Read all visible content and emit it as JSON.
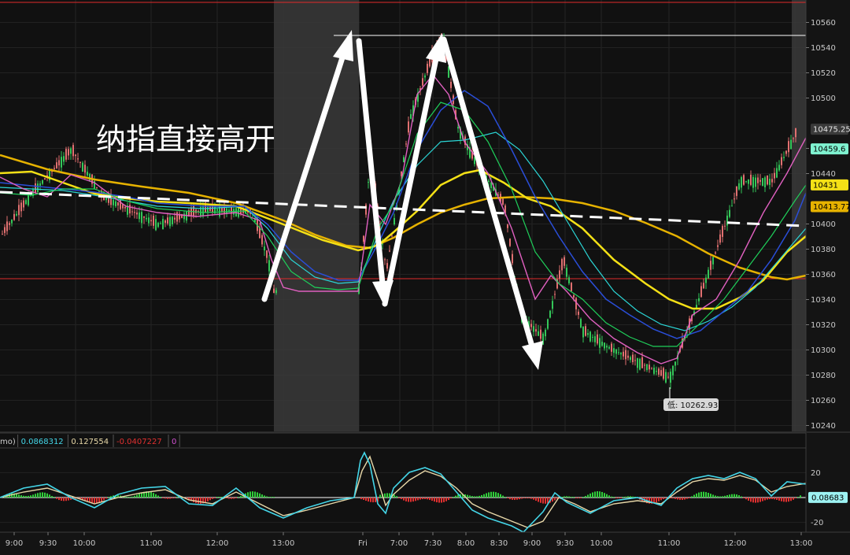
{
  "annotation": {
    "text": "纳指直接高开"
  },
  "price_axis": {
    "ticks": [
      {
        "label": "10560",
        "value": 10560
      },
      {
        "label": "10540",
        "value": 10540
      },
      {
        "label": "10520",
        "value": 10520
      },
      {
        "label": "10500",
        "value": 10500
      },
      {
        "label": "10460",
        "value": 10460
      },
      {
        "label": "10440",
        "value": 10440
      },
      {
        "label": "10400",
        "value": 10400
      },
      {
        "label": "10380",
        "value": 10380
      },
      {
        "label": "10360",
        "value": 10360
      },
      {
        "label": "10340",
        "value": 10340
      },
      {
        "label": "10320",
        "value": 10320
      },
      {
        "label": "10300",
        "value": 10300
      },
      {
        "label": "10280",
        "value": 10280
      },
      {
        "label": "10260",
        "value": 10260
      },
      {
        "label": "10240",
        "value": 10240
      }
    ],
    "tags": [
      {
        "label": "10475.25",
        "value": 10475.25,
        "bg": "#3a3a3a",
        "fg": "#e6e6e6"
      },
      {
        "label": "10459.6",
        "value": 10459.6,
        "bg": "#7ff2d0",
        "fg": "#000000"
      },
      {
        "label": "10431",
        "value": 10431,
        "bg": "#f4e016",
        "fg": "#000000"
      },
      {
        "label": "10413.77",
        "value": 10413.77,
        "bg": "#e6b200",
        "fg": "#000000"
      }
    ]
  },
  "low_label": {
    "text": "低: 10262.93",
    "value": 10262.93
  },
  "time_axis": {
    "labels": [
      "9:00",
      "9:30",
      "10:00",
      "11:00",
      "12:00",
      "13:00",
      "Fri",
      "7:00",
      "7:30",
      "8:00",
      "8:30",
      "9:00",
      "9:30",
      "10:00",
      "11:00",
      "12:00",
      "13:00"
    ]
  },
  "indicator": {
    "values": [
      {
        "text": "mo)",
        "color": "#cfcfcf"
      },
      {
        "text": "0.0868312",
        "color": "#44d6e8"
      },
      {
        "text": "0.127554",
        "color": "#e8d8a8"
      },
      {
        "text": "-0.0407227",
        "color": "#e23030"
      },
      {
        "text": "0",
        "color": "#d050d0"
      }
    ],
    "ticks": [
      {
        "label": "20",
        "value": 20
      },
      {
        "label": "-20",
        "value": -20
      }
    ],
    "tag": {
      "label": "0.08683",
      "value": 0.08683,
      "bg": "#9df3f3"
    }
  },
  "colors": {
    "accent_red_line": "#e02a2a",
    "white_dashed_trend": "#ffffff",
    "ma_yellow": "#f4e016",
    "ma_gold": "#e6b200",
    "ma_cyan": "#2bd6d6",
    "ma_blue": "#2a4ed8",
    "ma_pink": "#e060c0",
    "ma_green": "#1fcf5a",
    "candle_up": "#34c759",
    "candle_down": "#e07070",
    "session_shade": "#3a3a3a"
  }
}
